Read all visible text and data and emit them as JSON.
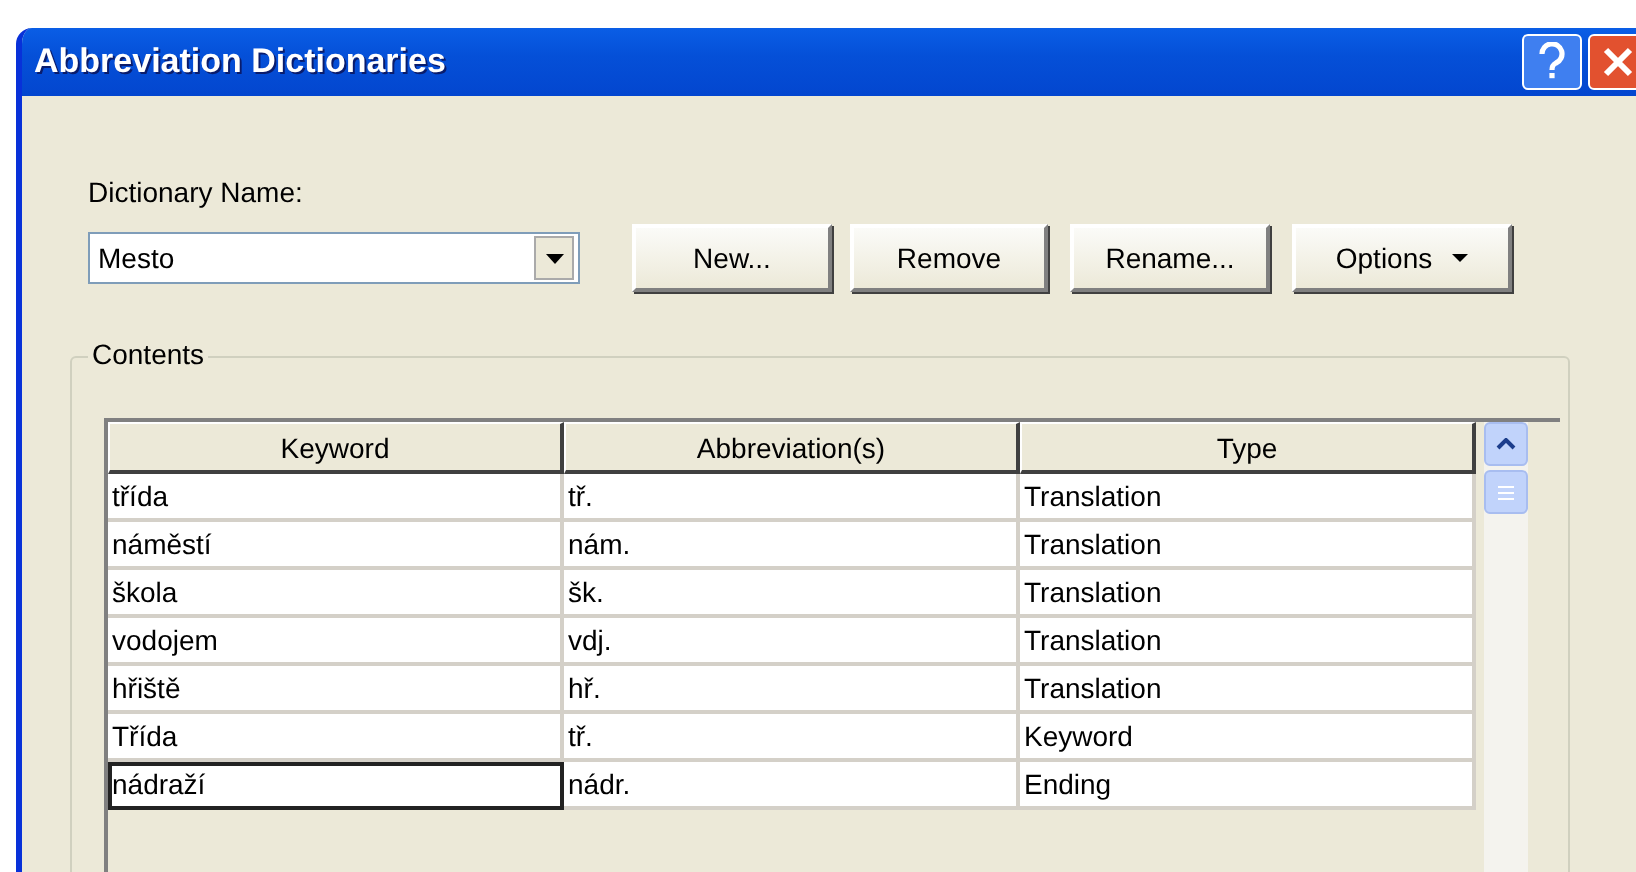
{
  "window": {
    "title": "Abbreviation Dictionaries"
  },
  "dictionary": {
    "label": "Dictionary Name:",
    "value": "Mesto"
  },
  "buttons": [
    {
      "label": "New...",
      "kind": "plain"
    },
    {
      "label": "Remove",
      "kind": "plain"
    },
    {
      "label": "Rename...",
      "kind": "plain"
    },
    {
      "label": "Options",
      "kind": "menu"
    }
  ],
  "contents": {
    "title": "Contents",
    "table": {
      "columns": [
        "Keyword",
        "Abbreviation(s)",
        "Type"
      ],
      "rows": [
        {
          "cells": [
            "třída",
            "tř.",
            "Translation"
          ],
          "selected": false
        },
        {
          "cells": [
            "náměstí",
            "nám.",
            "Translation"
          ],
          "selected": false
        },
        {
          "cells": [
            "škola",
            "šk.",
            "Translation"
          ],
          "selected": false
        },
        {
          "cells": [
            "vodojem",
            "vdj.",
            "Translation"
          ],
          "selected": false
        },
        {
          "cells": [
            "hřiště",
            "hř.",
            "Translation"
          ],
          "selected": false
        },
        {
          "cells": [
            "Třída",
            "tř.",
            "Keyword"
          ],
          "selected": false
        },
        {
          "cells": [
            "nádraží",
            "nádr.",
            "Ending"
          ],
          "selected": true
        }
      ]
    }
  }
}
